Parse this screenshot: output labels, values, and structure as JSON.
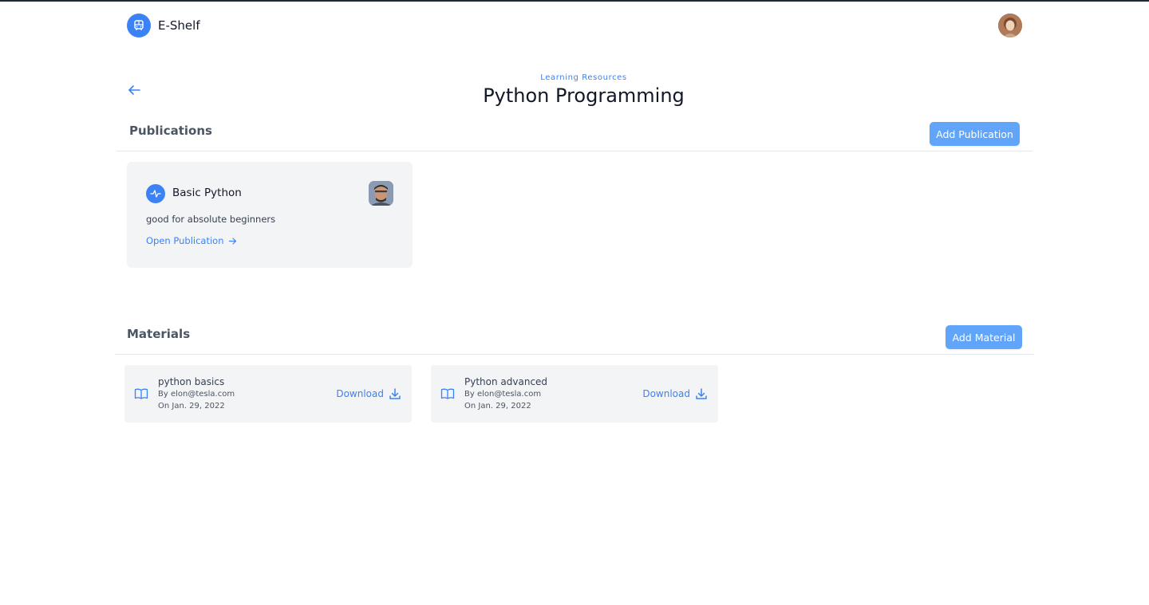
{
  "header": {
    "app_name": "E-Shelf",
    "logo_icon": "bus-icon",
    "avatar_icon": "user-avatar"
  },
  "page": {
    "eyebrow": "Learning Resources",
    "title": "Python Programming",
    "back_icon": "arrow-left-icon"
  },
  "publications": {
    "heading": "Publications",
    "add_label": "Add Publication",
    "items": [
      {
        "title": "Basic Python",
        "description": "good for absolute beginners",
        "link_label": "Open Publication",
        "icon": "activity-icon"
      }
    ]
  },
  "materials": {
    "heading": "Materials",
    "add_label": "Add Material",
    "items": [
      {
        "title": "python basics",
        "author": "By elon@tesla.com",
        "date": "On Jan. 29, 2022",
        "download_label": "Download"
      },
      {
        "title": "Python advanced",
        "author": "By elon@tesla.com",
        "date": "On Jan. 29, 2022",
        "download_label": "Download"
      }
    ]
  },
  "colors": {
    "accent": "#3b82f6",
    "button": "#60a5fa",
    "card_bg": "#f3f4f6"
  }
}
